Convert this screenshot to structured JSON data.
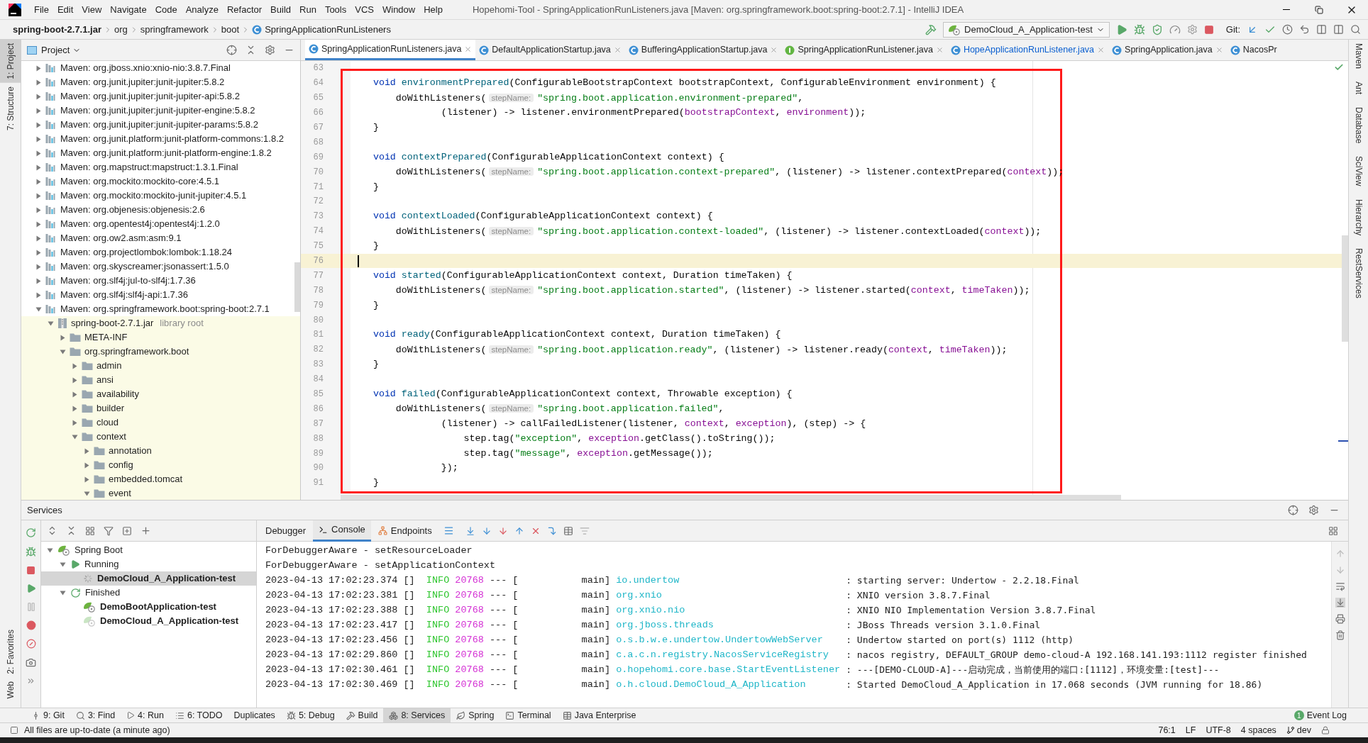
{
  "window": {
    "title": "Hopehomi-Tool - SpringApplicationRunListeners.java [Maven: org.springframework.boot:spring-boot:2.7.1] - IntelliJ IDEA"
  },
  "menu": [
    "File",
    "Edit",
    "View",
    "Navigate",
    "Code",
    "Analyze",
    "Refactor",
    "Build",
    "Run",
    "Tools",
    "VCS",
    "Window",
    "Help"
  ],
  "breadcrumbs": [
    {
      "label": "spring-boot-2.7.1.jar",
      "kind": "jar"
    },
    {
      "label": "org",
      "kind": "package"
    },
    {
      "label": "springframework",
      "kind": "package"
    },
    {
      "label": "boot",
      "kind": "package"
    },
    {
      "label": "SpringApplicationRunListeners",
      "kind": "class"
    }
  ],
  "run_config": "DemoCloud_A_Application-test",
  "git_label": "Git:",
  "left_stripe": [
    {
      "label": "1: Project",
      "selected": true
    },
    {
      "label": "7: Structure",
      "selected": false
    }
  ],
  "left_stripe_bottom": [
    "2: Favorites",
    "Web"
  ],
  "right_stripe": [
    "Maven",
    "Ant",
    "Database",
    "SciView",
    "Hierarchy",
    "RestServices"
  ],
  "project": {
    "title": "Project",
    "tree": [
      {
        "label": "Maven: org.jboss.xnio:xnio-nio:3.8.7.Final",
        "kind": "library",
        "expanded": false
      },
      {
        "label": "Maven: org.junit.jupiter:junit-jupiter:5.8.2",
        "kind": "library",
        "expanded": false
      },
      {
        "label": "Maven: org.junit.jupiter:junit-jupiter-api:5.8.2",
        "kind": "library",
        "expanded": false
      },
      {
        "label": "Maven: org.junit.jupiter:junit-jupiter-engine:5.8.2",
        "kind": "library",
        "expanded": false
      },
      {
        "label": "Maven: org.junit.jupiter:junit-jupiter-params:5.8.2",
        "kind": "library",
        "expanded": false
      },
      {
        "label": "Maven: org.junit.platform:junit-platform-commons:1.8.2",
        "kind": "library",
        "expanded": false
      },
      {
        "label": "Maven: org.junit.platform:junit-platform-engine:1.8.2",
        "kind": "library",
        "expanded": false
      },
      {
        "label": "Maven: org.mapstruct:mapstruct:1.3.1.Final",
        "kind": "library",
        "expanded": false
      },
      {
        "label": "Maven: org.mockito:mockito-core:4.5.1",
        "kind": "library",
        "expanded": false
      },
      {
        "label": "Maven: org.mockito:mockito-junit-jupiter:4.5.1",
        "kind": "library",
        "expanded": false
      },
      {
        "label": "Maven: org.objenesis:objenesis:2.6",
        "kind": "library",
        "expanded": false
      },
      {
        "label": "Maven: org.opentest4j:opentest4j:1.2.0",
        "kind": "library",
        "expanded": false
      },
      {
        "label": "Maven: org.ow2.asm:asm:9.1",
        "kind": "library",
        "expanded": false
      },
      {
        "label": "Maven: org.projectlombok:lombok:1.18.24",
        "kind": "library",
        "expanded": false
      },
      {
        "label": "Maven: org.skyscreamer:jsonassert:1.5.0",
        "kind": "library",
        "expanded": false
      },
      {
        "label": "Maven: org.slf4j:jul-to-slf4j:1.7.36",
        "kind": "library",
        "expanded": false
      },
      {
        "label": "Maven: org.slf4j:slf4j-api:1.7.36",
        "kind": "library",
        "expanded": false
      },
      {
        "label": "Maven: org.springframework.boot:spring-boot:2.7.1",
        "kind": "library",
        "expanded": true,
        "children": [
          {
            "label": "spring-boot-2.7.1.jar",
            "hint": "library root",
            "kind": "jar",
            "expanded": true,
            "children": [
              {
                "label": "META-INF",
                "kind": "folder",
                "expanded": false
              },
              {
                "label": "org.springframework.boot",
                "kind": "folder",
                "expanded": true,
                "children": [
                  {
                    "label": "admin",
                    "kind": "folder",
                    "expanded": false
                  },
                  {
                    "label": "ansi",
                    "kind": "folder",
                    "expanded": false
                  },
                  {
                    "label": "availability",
                    "kind": "folder",
                    "expanded": false
                  },
                  {
                    "label": "builder",
                    "kind": "folder",
                    "expanded": false
                  },
                  {
                    "label": "cloud",
                    "kind": "folder",
                    "expanded": false
                  },
                  {
                    "label": "context",
                    "kind": "folder",
                    "expanded": true,
                    "children": [
                      {
                        "label": "annotation",
                        "kind": "folder",
                        "expanded": false
                      },
                      {
                        "label": "config",
                        "kind": "folder",
                        "expanded": false
                      },
                      {
                        "label": "embedded.tomcat",
                        "kind": "folder",
                        "expanded": false
                      },
                      {
                        "label": "event",
                        "kind": "folder",
                        "expanded": true
                      }
                    ]
                  }
                ]
              }
            ]
          }
        ]
      }
    ]
  },
  "editor": {
    "tabs": [
      {
        "label": "SpringApplicationRunListeners.java",
        "kind": "class",
        "selected": true,
        "modified": false
      },
      {
        "label": "DefaultApplicationStartup.java",
        "kind": "class",
        "selected": false,
        "modified": false
      },
      {
        "label": "BufferingApplicationStartup.java",
        "kind": "class",
        "selected": false,
        "modified": false
      },
      {
        "label": "SpringApplicationRunListener.java",
        "kind": "interface",
        "selected": false,
        "modified": false
      },
      {
        "label": "HopeApplicationRunListener.java",
        "kind": "class",
        "selected": false,
        "modified": true
      },
      {
        "label": "SpringApplication.java",
        "kind": "class",
        "selected": false,
        "modified": false
      },
      {
        "label": "NacosPr",
        "kind": "class",
        "selected": false,
        "modified": false
      }
    ],
    "lines": [
      {
        "number": "63",
        "current": false
      },
      {
        "number": "64",
        "current": false,
        "tokens": [
          {
            "kind": "keyword",
            "text": "    void"
          },
          {
            "kind": "method",
            "text": " environmentPrepared"
          },
          {
            "kind": "plain",
            "text": "(ConfigurableBootstrapContext bootstrapContext, ConfigurableEnvironment environment) {"
          }
        ]
      },
      {
        "number": "65",
        "current": false,
        "tokens": [
          {
            "kind": "plain",
            "text": "        doWithListeners("
          },
          {
            "kind": "hint",
            "text": "stepName:"
          },
          {
            "kind": "string",
            "text": "\"spring.boot.application.environment-prepared\""
          },
          {
            "kind": "plain",
            "text": ","
          }
        ]
      },
      {
        "number": "66",
        "current": false,
        "tokens": [
          {
            "kind": "plain",
            "text": "                (listener) -> listener.environmentPrepared("
          },
          {
            "kind": "param",
            "text": "bootstrapContext"
          },
          {
            "kind": "plain",
            "text": ", "
          },
          {
            "kind": "param",
            "text": "environment"
          },
          {
            "kind": "plain",
            "text": "));"
          }
        ]
      },
      {
        "number": "67",
        "current": false,
        "tokens": [
          {
            "kind": "plain",
            "text": "    }"
          }
        ]
      },
      {
        "number": "68",
        "current": false
      },
      {
        "number": "69",
        "current": false,
        "tokens": [
          {
            "kind": "keyword",
            "text": "    void"
          },
          {
            "kind": "method",
            "text": " contextPrepared"
          },
          {
            "kind": "plain",
            "text": "(ConfigurableApplicationContext context) {"
          }
        ]
      },
      {
        "number": "70",
        "current": false,
        "tokens": [
          {
            "kind": "plain",
            "text": "        doWithListeners("
          },
          {
            "kind": "hint",
            "text": "stepName:"
          },
          {
            "kind": "string",
            "text": "\"spring.boot.application.context-prepared\""
          },
          {
            "kind": "plain",
            "text": ", (listener) -> listener.contextPrepared("
          },
          {
            "kind": "param",
            "text": "context"
          },
          {
            "kind": "plain",
            "text": "));"
          }
        ]
      },
      {
        "number": "71",
        "current": false,
        "tokens": [
          {
            "kind": "plain",
            "text": "    }"
          }
        ]
      },
      {
        "number": "72",
        "current": false
      },
      {
        "number": "73",
        "current": false,
        "tokens": [
          {
            "kind": "keyword",
            "text": "    void"
          },
          {
            "kind": "method",
            "text": " contextLoaded"
          },
          {
            "kind": "plain",
            "text": "(ConfigurableApplicationContext context) {"
          }
        ]
      },
      {
        "number": "74",
        "current": false,
        "tokens": [
          {
            "kind": "plain",
            "text": "        doWithListeners("
          },
          {
            "kind": "hint",
            "text": "stepName:"
          },
          {
            "kind": "string",
            "text": "\"spring.boot.application.context-loaded\""
          },
          {
            "kind": "plain",
            "text": ", (listener) -> listener.contextLoaded("
          },
          {
            "kind": "param",
            "text": "context"
          },
          {
            "kind": "plain",
            "text": "));"
          }
        ]
      },
      {
        "number": "75",
        "current": false,
        "tokens": [
          {
            "kind": "plain",
            "text": "    }"
          }
        ]
      },
      {
        "number": "76",
        "current": true
      },
      {
        "number": "77",
        "current": false,
        "tokens": [
          {
            "kind": "keyword",
            "text": "    void"
          },
          {
            "kind": "method",
            "text": " started"
          },
          {
            "kind": "plain",
            "text": "(ConfigurableApplicationContext context, Duration timeTaken) {"
          }
        ]
      },
      {
        "number": "78",
        "current": false,
        "tokens": [
          {
            "kind": "plain",
            "text": "        doWithListeners("
          },
          {
            "kind": "hint",
            "text": "stepName:"
          },
          {
            "kind": "string",
            "text": "\"spring.boot.application.started\""
          },
          {
            "kind": "plain",
            "text": ", (listener) -> listener.started("
          },
          {
            "kind": "param",
            "text": "context"
          },
          {
            "kind": "plain",
            "text": ", "
          },
          {
            "kind": "param",
            "text": "timeTaken"
          },
          {
            "kind": "plain",
            "text": "));"
          }
        ]
      },
      {
        "number": "79",
        "current": false,
        "tokens": [
          {
            "kind": "plain",
            "text": "    }"
          }
        ]
      },
      {
        "number": "80",
        "current": false
      },
      {
        "number": "81",
        "current": false,
        "tokens": [
          {
            "kind": "keyword",
            "text": "    void"
          },
          {
            "kind": "method",
            "text": " ready"
          },
          {
            "kind": "plain",
            "text": "(ConfigurableApplicationContext context, Duration timeTaken) {"
          }
        ]
      },
      {
        "number": "82",
        "current": false,
        "tokens": [
          {
            "kind": "plain",
            "text": "        doWithListeners("
          },
          {
            "kind": "hint",
            "text": "stepName:"
          },
          {
            "kind": "string",
            "text": "\"spring.boot.application.ready\""
          },
          {
            "kind": "plain",
            "text": ", (listener) -> listener.ready("
          },
          {
            "kind": "param",
            "text": "context"
          },
          {
            "kind": "plain",
            "text": ", "
          },
          {
            "kind": "param",
            "text": "timeTaken"
          },
          {
            "kind": "plain",
            "text": "));"
          }
        ]
      },
      {
        "number": "83",
        "current": false,
        "tokens": [
          {
            "kind": "plain",
            "text": "    }"
          }
        ]
      },
      {
        "number": "84",
        "current": false
      },
      {
        "number": "85",
        "current": false,
        "tokens": [
          {
            "kind": "keyword",
            "text": "    void"
          },
          {
            "kind": "method",
            "text": " failed"
          },
          {
            "kind": "plain",
            "text": "(ConfigurableApplicationContext context, Throwable exception) {"
          }
        ]
      },
      {
        "number": "86",
        "current": false,
        "tokens": [
          {
            "kind": "plain",
            "text": "        doWithListeners("
          },
          {
            "kind": "hint",
            "text": "stepName:"
          },
          {
            "kind": "string",
            "text": "\"spring.boot.application.failed\""
          },
          {
            "kind": "plain",
            "text": ","
          }
        ]
      },
      {
        "number": "87",
        "current": false,
        "tokens": [
          {
            "kind": "plain",
            "text": "                (listener) -> callFailedListener(listener, "
          },
          {
            "kind": "param",
            "text": "context"
          },
          {
            "kind": "plain",
            "text": ", "
          },
          {
            "kind": "param",
            "text": "exception"
          },
          {
            "kind": "plain",
            "text": "), (step) -> {"
          }
        ]
      },
      {
        "number": "88",
        "current": false,
        "tokens": [
          {
            "kind": "plain",
            "text": "                    step.tag("
          },
          {
            "kind": "string",
            "text": "\"exception\""
          },
          {
            "kind": "plain",
            "text": ", "
          },
          {
            "kind": "param",
            "text": "exception"
          },
          {
            "kind": "plain",
            "text": ".getClass().toString());"
          }
        ]
      },
      {
        "number": "89",
        "current": false,
        "tokens": [
          {
            "kind": "plain",
            "text": "                    step.tag("
          },
          {
            "kind": "string",
            "text": "\"message\""
          },
          {
            "kind": "plain",
            "text": ", "
          },
          {
            "kind": "param",
            "text": "exception"
          },
          {
            "kind": "plain",
            "text": ".getMessage());"
          }
        ]
      },
      {
        "number": "90",
        "current": false,
        "tokens": [
          {
            "kind": "plain",
            "text": "                });"
          }
        ]
      },
      {
        "number": "91",
        "current": false,
        "tokens": [
          {
            "kind": "plain",
            "text": "    }"
          }
        ]
      }
    ]
  },
  "services": {
    "title": "Services",
    "tree": [
      {
        "label": "Spring Boot",
        "kind": "spring-boot",
        "expanded": true,
        "selected": false,
        "children": [
          {
            "label": "Running",
            "kind": "running",
            "expanded": true,
            "selected": false,
            "children": [
              {
                "label": "DemoCloud_A_Application-test",
                "kind": "app-running",
                "selected": true
              }
            ]
          },
          {
            "label": "Finished",
            "kind": "finished",
            "expanded": true,
            "selected": false,
            "children": [
              {
                "label": "DemoBootApplication-test",
                "kind": "app",
                "selected": false
              },
              {
                "label": "DemoCloud_A_Application-test",
                "kind": "app-stopped",
                "selected": false
              }
            ]
          }
        ]
      }
    ],
    "tabs": [
      {
        "label": "Debugger",
        "selected": false
      },
      {
        "label": "Console",
        "selected": true
      },
      {
        "label": "Endpoints",
        "selected": false
      }
    ],
    "console": [
      {
        "kind": "text",
        "text": "ForDebuggerAware - setResourceLoader"
      },
      {
        "kind": "text",
        "text": "ForDebuggerAware - setApplicationContext"
      },
      {
        "kind": "log",
        "time": "2023-04-13 17:02:23.374",
        "context": "[]",
        "level": "INFO",
        "pid": "20768",
        "separator": "--- [",
        "thread": "main]",
        "logger": "io.undertow",
        "message": ": starting server: Undertow - 2.2.18.Final"
      },
      {
        "kind": "log",
        "time": "2023-04-13 17:02:23.381",
        "context": "[]",
        "level": "INFO",
        "pid": "20768",
        "separator": "--- [",
        "thread": "main]",
        "logger": "org.xnio",
        "message": ": XNIO version 3.8.7.Final"
      },
      {
        "kind": "log",
        "time": "2023-04-13 17:02:23.388",
        "context": "[]",
        "level": "INFO",
        "pid": "20768",
        "separator": "--- [",
        "thread": "main]",
        "logger": "org.xnio.nio",
        "message": ": XNIO NIO Implementation Version 3.8.7.Final"
      },
      {
        "kind": "log",
        "time": "2023-04-13 17:02:23.417",
        "context": "[]",
        "level": "INFO",
        "pid": "20768",
        "separator": "--- [",
        "thread": "main]",
        "logger": "org.jboss.threads",
        "message": ": JBoss Threads version 3.1.0.Final"
      },
      {
        "kind": "log",
        "time": "2023-04-13 17:02:23.456",
        "context": "[]",
        "level": "INFO",
        "pid": "20768",
        "separator": "--- [",
        "thread": "main]",
        "logger": "o.s.b.w.e.undertow.UndertowWebServer",
        "message": ": Undertow started on port(s) 1112 (http)"
      },
      {
        "kind": "log",
        "time": "2023-04-13 17:02:29.860",
        "context": "[]",
        "level": "INFO",
        "pid": "20768",
        "separator": "--- [",
        "thread": "main]",
        "logger": "c.a.c.n.registry.NacosServiceRegistry",
        "message": ": nacos registry, DEFAULT_GROUP demo-cloud-A 192.168.141.193:1112 register finished"
      },
      {
        "kind": "log",
        "time": "2023-04-13 17:02:30.461",
        "context": "[]",
        "level": "INFO",
        "pid": "20768",
        "separator": "--- [",
        "thread": "main]",
        "logger": "o.hopehomi.core.base.StartEventListener",
        "message": ": ---[DEMO-CLOUD-A]---启动完成，当前使用的端口:[1112]，环境变量:[test]---"
      },
      {
        "kind": "log",
        "time": "2023-04-13 17:02:30.469",
        "context": "[]",
        "level": "INFO",
        "pid": "20768",
        "separator": "--- [",
        "thread": "main]",
        "logger": "o.h.cloud.DemoCloud_A_Application",
        "message": ": Started DemoCloud_A_Application in 17.068 seconds (JVM running for 18.86)"
      }
    ]
  },
  "tool_tabs": [
    {
      "label": "9: Git",
      "selected": false
    },
    {
      "label": "3: Find",
      "selected": false
    },
    {
      "label": "4: Run",
      "selected": false
    },
    {
      "label": "6: TODO",
      "selected": false
    },
    {
      "label": "Duplicates",
      "selected": false
    },
    {
      "label": "5: Debug",
      "selected": false
    },
    {
      "label": "Build",
      "selected": false
    },
    {
      "label": "8: Services",
      "selected": true
    },
    {
      "label": "Spring",
      "selected": false
    },
    {
      "label": "Terminal",
      "selected": false
    },
    {
      "label": "Java Enterprise",
      "selected": false
    }
  ],
  "event_log": {
    "label": "Event Log",
    "count": "1"
  },
  "status_bar": {
    "message": "All files are up-to-date (a minute ago)",
    "position": "76:1",
    "line_separator": "LF",
    "encoding": "UTF-8",
    "indent": "4 spaces",
    "branch": "dev"
  }
}
